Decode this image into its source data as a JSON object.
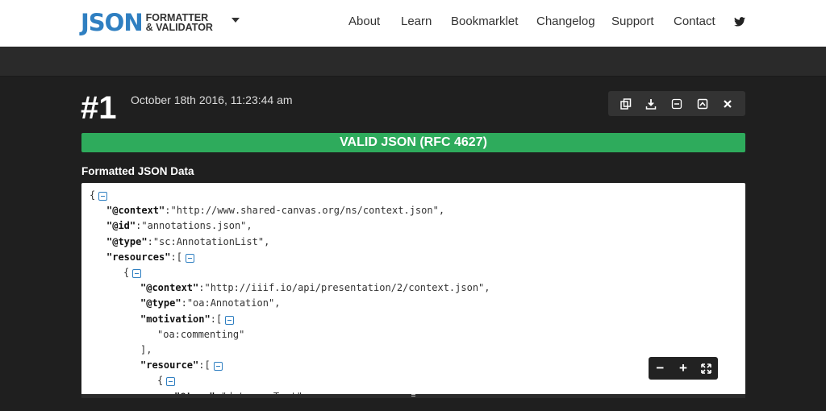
{
  "header": {
    "logo_main": "JSON",
    "logo_sub_1": "FORMATTER",
    "logo_sub_2": "& VALIDATOR",
    "nav": [
      "About",
      "Learn",
      "Bookmarklet",
      "Changelog",
      "Support",
      "Contact"
    ],
    "social_icon": "twitter-icon"
  },
  "result": {
    "number": "#1",
    "timestamp": "October 18th 2016, 11:23:44 am",
    "toolbar_icons": [
      "copy-icon",
      "download-icon",
      "collapse-icon",
      "expand-icon",
      "close-icon"
    ],
    "status": "VALID JSON (RFC 4627)",
    "section_label": "Formatted JSON Data"
  },
  "json_lines": [
    {
      "indent": 0,
      "open": "{"
    },
    {
      "indent": 1,
      "key": "\"@context\"",
      "value": "\"http://www.shared-canvas.org/ns/context.json\"",
      "comma": ","
    },
    {
      "indent": 1,
      "key": "\"@id\"",
      "value": "\"annotations.json\"",
      "comma": ","
    },
    {
      "indent": 1,
      "key": "\"@type\"",
      "value": "\"sc:AnnotationList\"",
      "comma": ","
    },
    {
      "indent": 1,
      "key": "\"resources\"",
      "open": "["
    },
    {
      "indent": 2,
      "open": "{"
    },
    {
      "indent": 3,
      "key": "\"@context\"",
      "value": "\"http://iiif.io/api/presentation/2/context.json\"",
      "comma": ","
    },
    {
      "indent": 3,
      "key": "\"@type\"",
      "value": "\"oa:Annotation\"",
      "comma": ","
    },
    {
      "indent": 3,
      "key": "\"motivation\"",
      "open": "["
    },
    {
      "indent": 4,
      "value": "\"oa:commenting\""
    },
    {
      "indent": 3,
      "value": "],"
    },
    {
      "indent": 3,
      "key": "\"resource\"",
      "open": "["
    },
    {
      "indent": 4,
      "open": "{"
    },
    {
      "indent": 5,
      "key": "\"@type\"",
      "value": "\"dctypes:Text\"",
      "comma": ","
    }
  ],
  "zoom_controls": {
    "zoom_out": "−",
    "zoom_in": "+",
    "fullscreen_icon": "fullscreen-icon"
  }
}
